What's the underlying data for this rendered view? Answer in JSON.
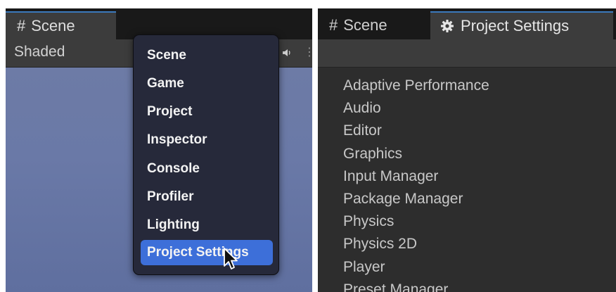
{
  "left_panel": {
    "tab": {
      "icon": "hash-icon",
      "label": "Scene"
    },
    "toolbar": {
      "shading_mode": "Shaded",
      "audio_icon": "audio-icon"
    },
    "menu": {
      "items": [
        "Scene",
        "Game",
        "Project",
        "Inspector",
        "Console",
        "Profiler",
        "Lighting",
        "Project Settings"
      ],
      "selected": "Project Settings"
    }
  },
  "right_panel": {
    "tabs": [
      {
        "icon": "hash-icon",
        "label": "Scene"
      },
      {
        "icon": "gear-icon",
        "label": "Project Settings",
        "active": true
      }
    ],
    "settings_list": [
      "Adaptive Performance",
      "Audio",
      "Editor",
      "Graphics",
      "Input Manager",
      "Package Manager",
      "Physics",
      "Physics 2D",
      "Player",
      "Preset Manager"
    ]
  },
  "colors": {
    "tab_accent": "#3a79bb",
    "menu_selected": "#3d6fd9",
    "menu_background": "#26293a",
    "viewport": "#6a79a7"
  }
}
